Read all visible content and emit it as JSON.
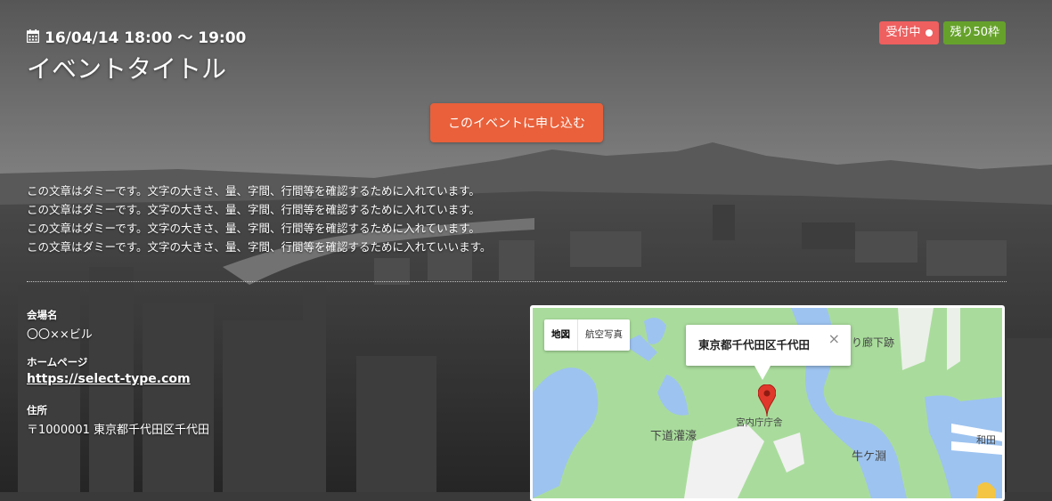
{
  "event": {
    "datetime": "16/04/14 18:00 〜 19:00",
    "title": "イベントタイトル",
    "status_badge": "受付中",
    "remaining_badge": "残り50枠",
    "apply_button": "このイベントに申し込む",
    "description": [
      "この文章はダミーです。文字の大きさ、量、字間、行間等を確認するために入れています。",
      "この文章はダミーです。文字の大きさ、量、字間、行間等を確認するために入れています。",
      "この文章はダミーです。文字の大きさ、量、字間、行間等を確認するために入れています。",
      "この文章はダミーです。文字の大きさ、量、字間、行間等を確認するために入れていいます。"
    ]
  },
  "venue": {
    "label": "会場名",
    "value": "〇〇××ビル"
  },
  "homepage": {
    "label": "ホームページ",
    "value": "https://select-type.com"
  },
  "address": {
    "label": "住所",
    "value": "〒1000001 東京都千代田区千代田"
  },
  "map": {
    "tab_map": "地図",
    "tab_satellite": "航空写真",
    "infowindow_text": "東京都千代田区千代田",
    "close": "×",
    "labels": {
      "corridor": "り廊下跡",
      "shimodoukan": "下道灌濠",
      "kunaicho": "宮内庁庁舎",
      "ushigafuchi": "牛ケ淵",
      "wada": "和田"
    }
  },
  "colors": {
    "badge_open": "#ee5f5f",
    "badge_remaining": "#66a22b",
    "apply_button": "#e9603a"
  },
  "icons": {
    "date": "calendar-icon",
    "badge_dot": "dot-icon",
    "map_pin": "map-pin-icon",
    "close": "close-icon"
  }
}
